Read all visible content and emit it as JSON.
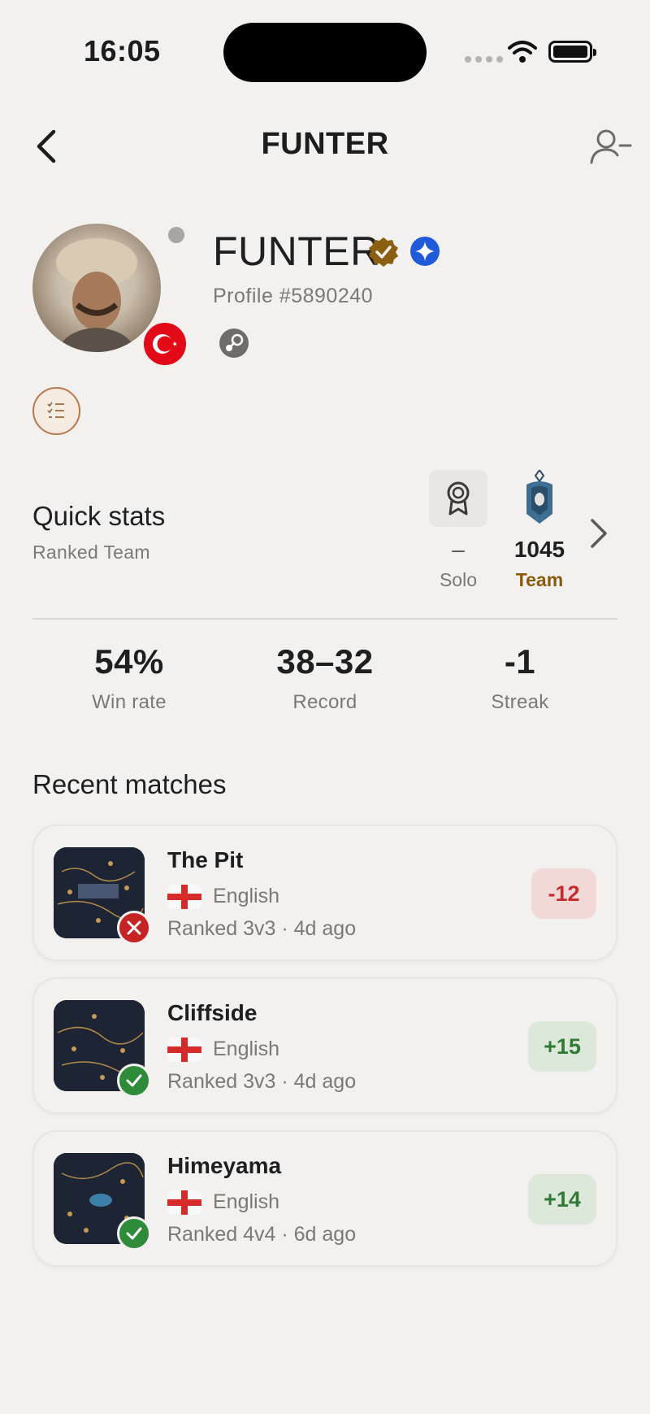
{
  "status_bar": {
    "time": "16:05"
  },
  "nav": {
    "title": "FUNTER"
  },
  "profile": {
    "name": "FUNTER",
    "profile_id": "Profile #5890240"
  },
  "quick_stats": {
    "title": "Quick stats",
    "subtitle": "Ranked Team",
    "solo": {
      "value": "–",
      "label": "Solo"
    },
    "team": {
      "value": "1045",
      "label": "Team"
    },
    "win_rate": {
      "value": "54%",
      "label": "Win rate"
    },
    "record": {
      "value": "38–32",
      "label": "Record"
    },
    "streak": {
      "value": "-1",
      "label": "Streak"
    }
  },
  "recent_matches": {
    "title": "Recent matches",
    "items": [
      {
        "map": "The Pit",
        "language": "English",
        "meta": "Ranked 3v3 · 4d ago",
        "delta": "-12",
        "result": "loss"
      },
      {
        "map": "Cliffside",
        "language": "English",
        "meta": "Ranked 3v3 · 4d ago",
        "delta": "+15",
        "result": "win"
      },
      {
        "map": "Himeyama",
        "language": "English",
        "meta": "Ranked 4v4 · 6d ago",
        "delta": "+14",
        "result": "win"
      }
    ]
  },
  "colors": {
    "background": "#f3f1ef",
    "team_accent": "#8a5a0c",
    "loss_red": "#c62424",
    "win_green": "#2e8b3a"
  },
  "icons": [
    "back-chevron-icon",
    "remove-user-icon",
    "verified-icon",
    "star-badge-icon",
    "steam-icon",
    "checklist-icon",
    "medal-icon",
    "rank-team-icon",
    "chevron-right-icon",
    "close-icon",
    "check-icon",
    "england-flag-icon",
    "turkey-flag-icon"
  ]
}
